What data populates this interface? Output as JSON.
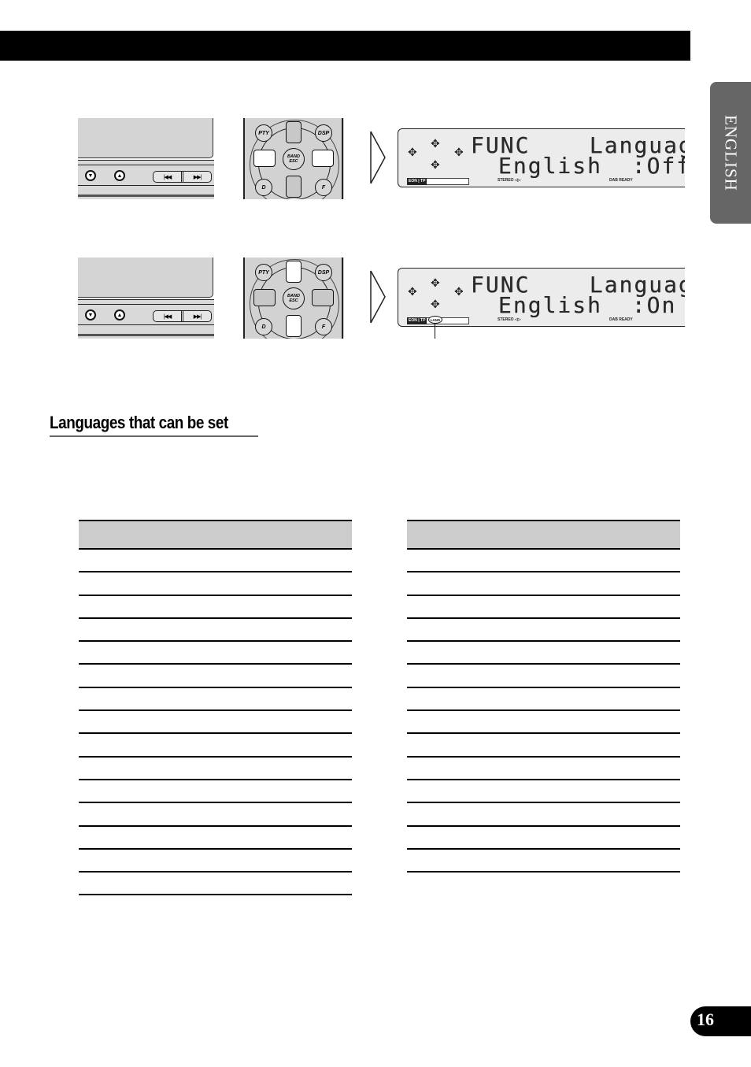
{
  "page": {
    "section_tab": "ENGLISH",
    "page_number": "16",
    "section_heading": "Languages that can be set"
  },
  "steps": [
    {
      "head_unit": {
        "buttons": [
          "▼",
          "▲"
        ],
        "seek_buttons": [
          "◀◀",
          "▶▶|"
        ],
        "seek_back_label": "|◀◀",
        "seek_fwd_label": "▶▶|"
      },
      "remote": {
        "labels": {
          "pty": "PTY",
          "dsp": "DSP",
          "d": "D",
          "f": "F",
          "band": "BAND",
          "esc": "ESC"
        },
        "highlighted": "left-right"
      },
      "display": {
        "line1_left": "FUNC",
        "line1_right": "Language",
        "line2_left": "English",
        "line2_right": ":Off",
        "indicators": {
          "eon": "EON",
          "tp": "TP",
          "stereo": "STEREO ◁▷",
          "dab": "DAB READY"
        },
        "lang_indicator": ""
      }
    },
    {
      "head_unit": {
        "buttons": [
          "▼",
          "▲"
        ],
        "seek_back_label": "|◀◀",
        "seek_fwd_label": "▶▶|"
      },
      "remote": {
        "labels": {
          "pty": "PTY",
          "dsp": "DSP",
          "d": "D",
          "f": "F",
          "band": "BAND",
          "esc": "ESC"
        },
        "highlighted": "up-down"
      },
      "display": {
        "line1_left": "FUNC",
        "line1_right": "Language",
        "line2_left": "English",
        "line2_right": ":On",
        "indicators": {
          "eon": "EON",
          "tp": "TP",
          "stereo": "STEREO ◁▷",
          "dab": "DAB READY"
        },
        "lang_indicator": "LANG"
      }
    }
  ],
  "tables": {
    "left": {
      "header": "",
      "rows": [
        "",
        "",
        "",
        "",
        "",
        "",
        "",
        "",
        "",
        "",
        "",
        "",
        "",
        "",
        ""
      ]
    },
    "right": {
      "header": "",
      "rows": [
        "",
        "",
        "",
        "",
        "",
        "",
        "",
        "",
        "",
        "",
        "",
        "",
        "",
        ""
      ]
    }
  }
}
